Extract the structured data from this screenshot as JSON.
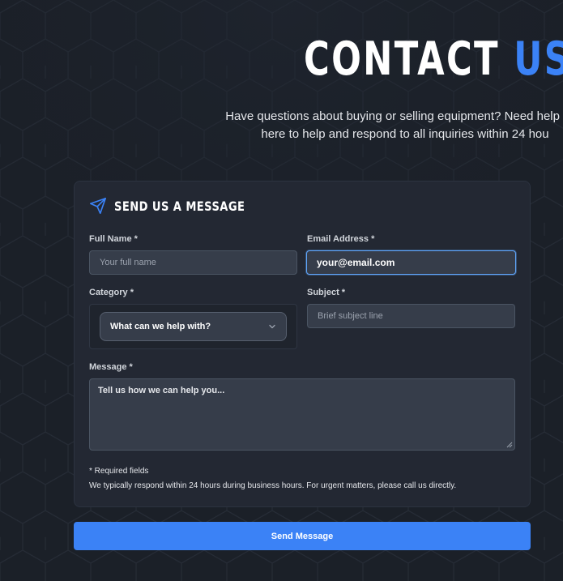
{
  "header": {
    "title_main": "CONTACT",
    "title_accent": "US",
    "subtitle_line1": "Have questions about buying or selling equipment? Need help with",
    "subtitle_line2": "here to help and respond to all inquiries within 24 hou"
  },
  "form": {
    "heading": "SEND US A MESSAGE",
    "icon": "send-icon",
    "full_name": {
      "label": "Full Name *",
      "placeholder": "Your full name",
      "value": ""
    },
    "email": {
      "label": "Email Address *",
      "placeholder": "your@email.com",
      "value": "your@email.com"
    },
    "category": {
      "label": "Category *",
      "selected": "What can we help with?"
    },
    "subject": {
      "label": "Subject *",
      "placeholder": "Brief subject line",
      "value": ""
    },
    "message": {
      "label": "Message *",
      "placeholder": "Tell us how we can help you..."
    },
    "required_note": "* Required fields",
    "response_note": "We typically respond within 24 hours during business hours. For urgent matters, please call us directly.",
    "submit_label": "Send Message"
  },
  "colors": {
    "background": "#1b2028",
    "card": "#232833",
    "accent": "#3b82f6",
    "input_background": "#363d4a",
    "focus_border": "#60a5fa"
  }
}
